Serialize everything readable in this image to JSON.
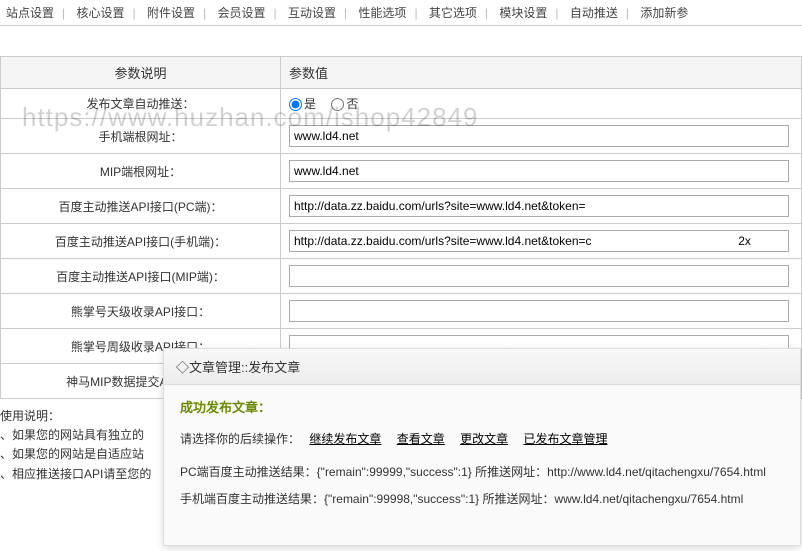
{
  "topnav": {
    "items": [
      "站点设置",
      "核心设置",
      "附件设置",
      "会员设置",
      "互动设置",
      "性能选项",
      "其它选项",
      "模块设置",
      "自动推送",
      "添加新参"
    ]
  },
  "watermark": "https://www.huzhan.com/ishop42849",
  "table": {
    "header_label": "参数说明",
    "header_value": "参数值",
    "rows": [
      {
        "label": "发布文章自动推送：",
        "type": "radio",
        "yes": "是",
        "no": "否",
        "value": "yes"
      },
      {
        "label": "手机端根网址：",
        "type": "text",
        "value": "www.ld4.net"
      },
      {
        "label": "MIP端根网址：",
        "type": "text",
        "value": "www.ld4.net"
      },
      {
        "label": "百度主动推送API接口(PC端)：",
        "type": "text",
        "value": "http://data.zz.baidu.com/urls?site=www.ld4.net&token="
      },
      {
        "label": "百度主动推送API接口(手机端)：",
        "type": "text",
        "value": "http://data.zz.baidu.com/urls?site=www.ld4.net&token=c                                            2x"
      },
      {
        "label": "百度主动推送API接口(MIP端)：",
        "type": "text",
        "value": ""
      },
      {
        "label": "熊掌号天级收录API接口：",
        "type": "text",
        "value": ""
      },
      {
        "label": "熊掌号周级收录API接口：",
        "type": "text",
        "value": ""
      },
      {
        "label": "神马MIP数据提交API接口：",
        "type": "text",
        "value": ""
      }
    ]
  },
  "usage": {
    "title": "使用说明：",
    "lines": [
      "、如果您的网站具有独立的",
      "、如果您的网站是自适应站",
      "、相应推送接口API请至您的"
    ]
  },
  "overlay": {
    "title": "◇文章管理::发布文章",
    "success": "成功发布文章：",
    "ops_prefix": "请选择你的后续操作：",
    "ops": [
      "继续发布文章",
      "查看文章",
      "更改文章",
      "已发布文章管理"
    ],
    "result_pc": "PC端百度主动推送结果：{\"remain\":99999,\"success\":1} 所推送网址：http://www.ld4.net/qitachengxu/7654.html",
    "result_mobile": "手机端百度主动推送结果：{\"remain\":99998,\"success\":1} 所推送网址：www.ld4.net/qitachengxu/7654.html"
  }
}
